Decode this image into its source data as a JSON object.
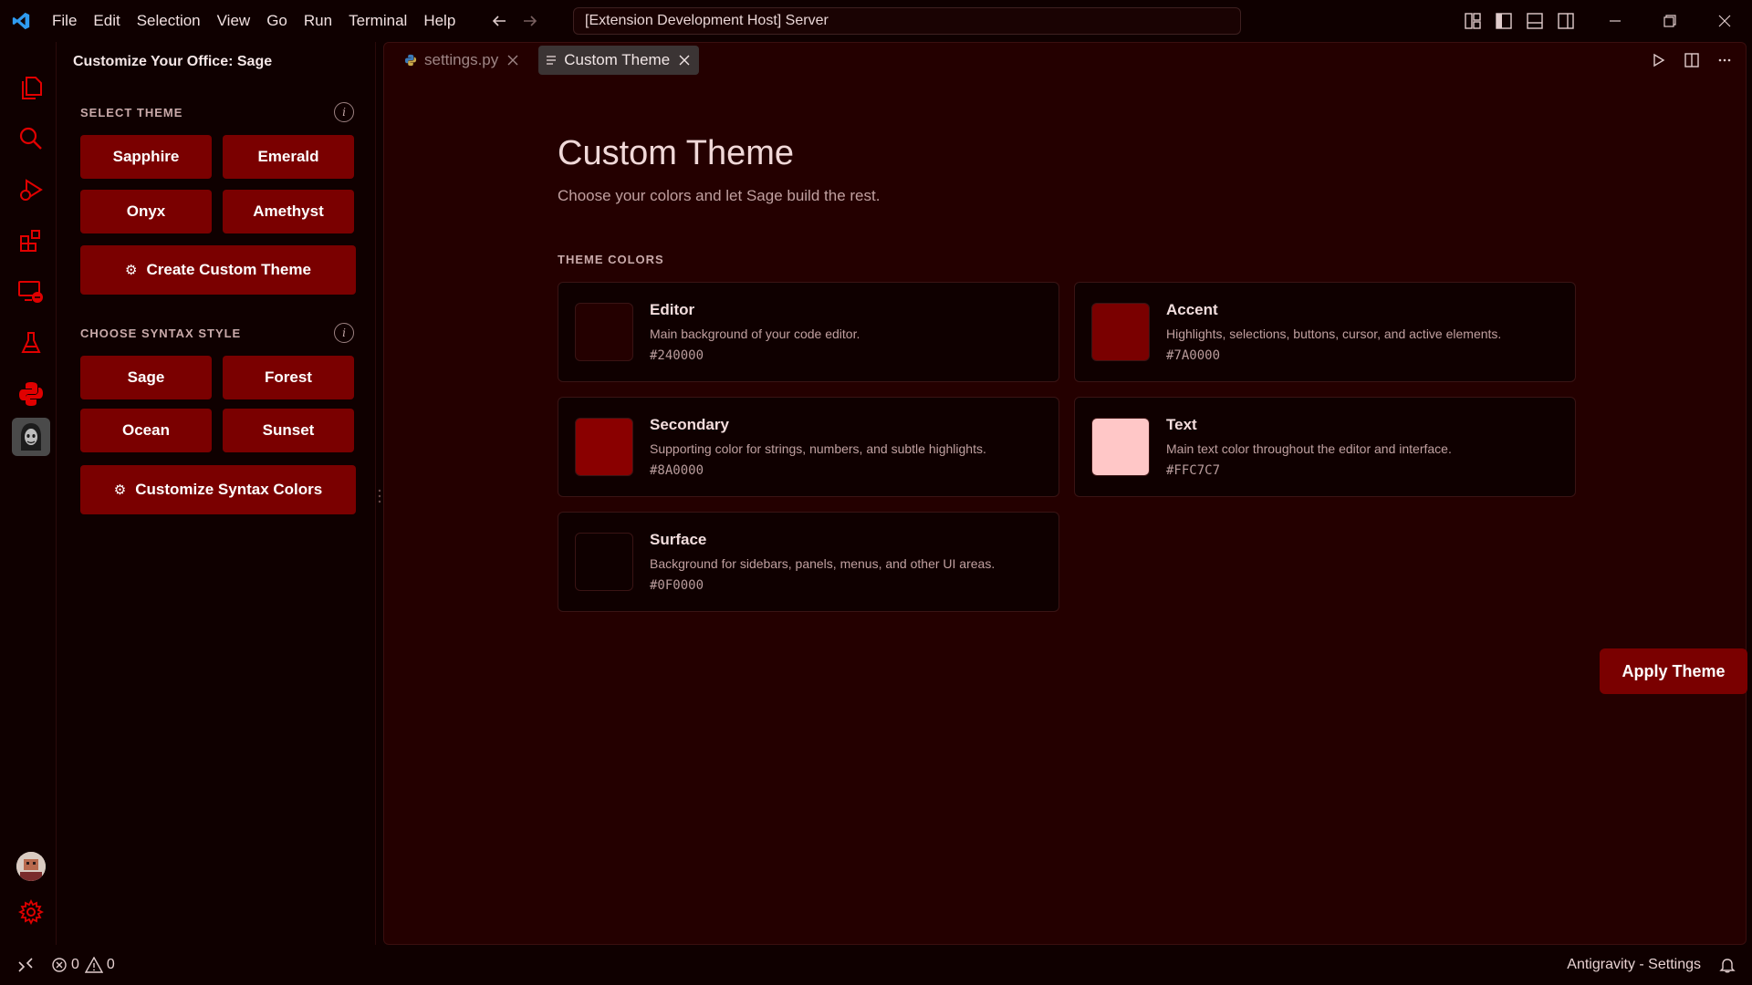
{
  "titlebar": {
    "menus": [
      "File",
      "Edit",
      "Selection",
      "View",
      "Go",
      "Run",
      "Terminal",
      "Help"
    ],
    "command_center": "[Extension Development Host] Server"
  },
  "sidebar": {
    "title": "Customize Your Office: Sage",
    "select_theme_header": "SELECT THEME",
    "themes": [
      "Sapphire",
      "Emerald",
      "Onyx",
      "Amethyst"
    ],
    "create_custom_label": "Create Custom Theme",
    "syntax_header": "CHOOSE SYNTAX STYLE",
    "syntax_styles": [
      "Sage",
      "Forest",
      "Ocean",
      "Sunset"
    ],
    "customize_syntax_label": "Customize Syntax Colors",
    "info_glyph": "i",
    "gear_glyph": "⚙"
  },
  "tabs": [
    {
      "label": "settings.py",
      "active": false,
      "icon": "python-file-icon"
    },
    {
      "label": "Custom Theme",
      "active": true,
      "icon": "preview-icon"
    }
  ],
  "main": {
    "title": "Custom Theme",
    "subtitle": "Choose your colors and let Sage build the rest.",
    "colors_header": "THEME COLORS",
    "colors": [
      {
        "name": "Editor",
        "description": "Main background of your code editor.",
        "hex": "#240000"
      },
      {
        "name": "Accent",
        "description": "Highlights, selections, buttons, cursor, and active elements.",
        "hex": "#7A0000"
      },
      {
        "name": "Secondary",
        "description": "Supporting color for strings, numbers, and subtle highlights.",
        "hex": "#8A0000"
      },
      {
        "name": "Text",
        "description": "Main text color throughout the editor and interface.",
        "hex": "#FFC7C7"
      },
      {
        "name": "Surface",
        "description": "Background for sidebars, panels, menus, and other UI areas.",
        "hex": "#0F0000"
      }
    ],
    "apply_label": "Apply Theme"
  },
  "statusbar": {
    "errors": "0",
    "warnings": "0",
    "right_text": "Antigravity - Settings"
  },
  "accent_color": "#7a0000"
}
